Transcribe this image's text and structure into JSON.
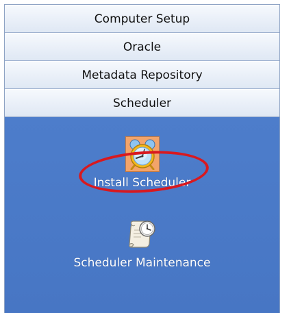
{
  "sections": [
    {
      "label": "Computer Setup"
    },
    {
      "label": "Oracle"
    },
    {
      "label": "Metadata Repository"
    },
    {
      "label": "Scheduler"
    }
  ],
  "items": [
    {
      "label": "Install Scheduler",
      "icon": "alarm-clock-icon",
      "selected": true
    },
    {
      "label": "Scheduler Maintenance",
      "icon": "scroll-clock-icon",
      "selected": false
    }
  ],
  "colors": {
    "panel_bg": "#4a79c7",
    "header_bg": "#e9eff8",
    "selected_bg": "#f3a46a",
    "highlight": "#d8191f"
  }
}
